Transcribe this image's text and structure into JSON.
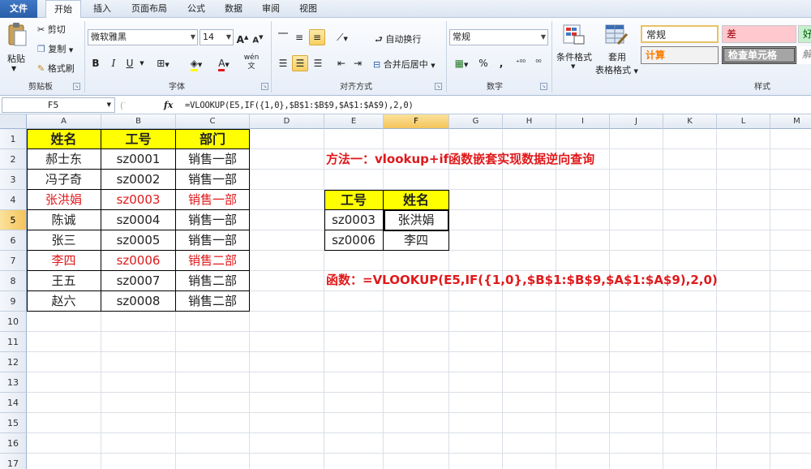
{
  "ribbon_tabs": [
    "文件",
    "开始",
    "插入",
    "页面布局",
    "公式",
    "数据",
    "审阅",
    "视图"
  ],
  "clipboard": {
    "paste": "粘贴",
    "cut": "剪切",
    "copy": "复制",
    "format_painter": "格式刷",
    "group": "剪贴板"
  },
  "font": {
    "name": "微软雅黑",
    "size": "14",
    "bold": "B",
    "italic": "I",
    "underline": "U",
    "grow": "A",
    "shrink": "A",
    "group": "字体",
    "wen": "wén"
  },
  "alignment": {
    "wrap": "自动换行",
    "merge": "合并后居中",
    "group": "对齐方式"
  },
  "number": {
    "format": "常规",
    "percent": "%",
    "comma": ",",
    "group": "数字"
  },
  "styles": {
    "conditional": "条件格式",
    "table_format": "套用",
    "table_format2": "表格格式",
    "normal": "常规",
    "bad": "差",
    "good": "好",
    "calc": "计算",
    "check": "检查单元格",
    "expl": "解",
    "group": "样式"
  },
  "formula_bar": {
    "name_box": "F5",
    "fx": "fx",
    "formula": "=VLOOKUP(E5,IF({1,0},$B$1:$B$9,$A$1:$A$9),2,0)"
  },
  "columns": [
    "A",
    "B",
    "C",
    "D",
    "E",
    "F",
    "G",
    "H",
    "I",
    "J",
    "K",
    "L",
    "M"
  ],
  "rows": [
    "1",
    "2",
    "3",
    "4",
    "5",
    "6",
    "7",
    "8",
    "9",
    "10",
    "11",
    "12",
    "13",
    "14",
    "15",
    "16",
    "17"
  ],
  "table": {
    "headers": [
      "姓名",
      "工号",
      "部门"
    ],
    "rows": [
      [
        "郝士东",
        "sz0001",
        "销售一部"
      ],
      [
        "冯子奇",
        "sz0002",
        "销售一部"
      ],
      [
        "张洪娟",
        "sz0003",
        "销售一部"
      ],
      [
        "陈诚",
        "sz0004",
        "销售一部"
      ],
      [
        "张三",
        "sz0005",
        "销售一部"
      ],
      [
        "李四",
        "sz0006",
        "销售二部"
      ],
      [
        "王五",
        "sz0007",
        "销售二部"
      ],
      [
        "赵六",
        "sz0008",
        "销售二部"
      ]
    ],
    "highlight_color": "#e0191b",
    "header_fill": "#ffff00"
  },
  "lookup": {
    "title": "方法一：vlookup+if函数嵌套实现数据逆向查询",
    "headers": [
      "工号",
      "姓名"
    ],
    "rows": [
      [
        "sz0003",
        "张洪娟"
      ],
      [
        "sz0006",
        "李四"
      ]
    ],
    "formula_note": "函数：=VLOOKUP(E5,IF({1,0},$B$1:$B$9,$A$1:$A$9),2,0)"
  },
  "accent": "#e0191b"
}
